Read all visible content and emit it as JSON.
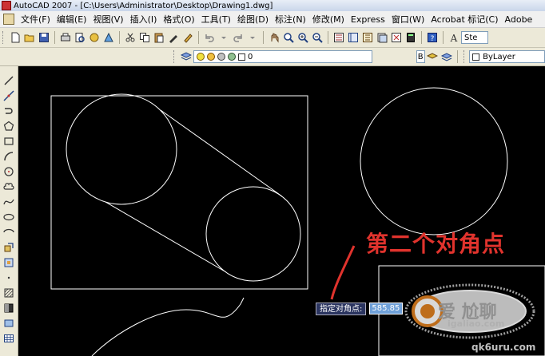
{
  "window": {
    "title": "AutoCAD 2007 - [C:\\Users\\Administrator\\Desktop\\Drawing1.dwg]"
  },
  "menu": {
    "items": [
      "文件(F)",
      "编辑(E)",
      "视图(V)",
      "插入(I)",
      "格式(O)",
      "工具(T)",
      "绘图(D)",
      "标注(N)",
      "修改(M)",
      "Express",
      "窗口(W)",
      "Acrobat 标记(C)",
      "Adobe"
    ]
  },
  "toolbar": {
    "text_style_value": "Ste",
    "layer_value": "0",
    "color_value": "ByLayer",
    "right_box_value": "B"
  },
  "prompt": {
    "label": "指定对角点:",
    "value": "585.85"
  },
  "annotation": {
    "text": "第二个对角点"
  },
  "watermark": {
    "main": "爱 尬聊",
    "site": "igaliao.com",
    "corner": "qk6uru.com"
  },
  "colors": {
    "annotation": "#e0332d",
    "drawing_lines": "#ffffff",
    "canvas": "#000000"
  }
}
